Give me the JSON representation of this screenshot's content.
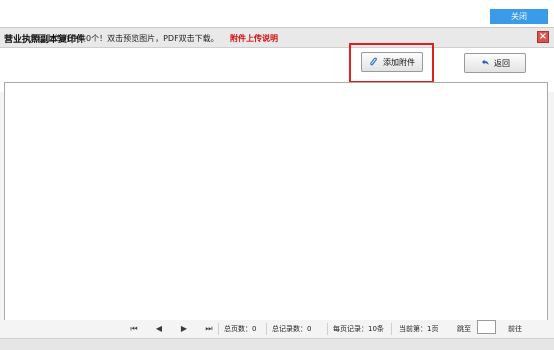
{
  "topbar": {
    "close_label": "关闭"
  },
  "dialog": {
    "title": "营业执照副本复印件",
    "info_text": "您已上传附件共0个！双击预览图片，PDF双击下载。",
    "upload_note": "附件上传说明",
    "add_button": "添加附件",
    "back_button": "返回"
  },
  "pager": {
    "total_pages": "总页数：0",
    "total_records": "总记录数：0",
    "per_page": "每页记录：10条",
    "current_page": "当前第：1页",
    "jump_label": "跳至",
    "go_label": "前往"
  },
  "colors": {
    "accent": "#3a9be8",
    "note_red": "#d01010",
    "highlight": "#e02020"
  }
}
